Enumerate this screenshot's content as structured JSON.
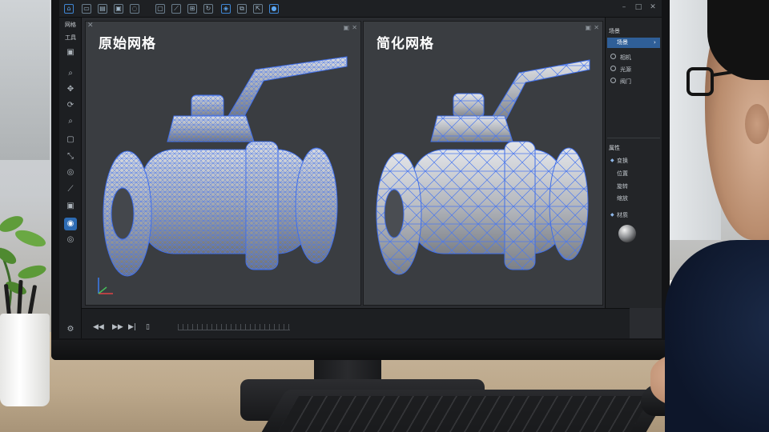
{
  "viewports": {
    "left_title": "原始网格",
    "right_title": "简化网格"
  },
  "left_toolbar": {
    "tab_1": "网格",
    "tab_2": "工具"
  },
  "scene_panel": {
    "title": "场景",
    "selected": "场景",
    "items": [
      "相机",
      "光源",
      "阀门"
    ]
  },
  "properties_panel": {
    "title": "属性",
    "section_transform": "变换",
    "items": [
      "位置",
      "旋转",
      "缩放"
    ],
    "section_material": "材质"
  },
  "colors": {
    "accent": "#2d6bb3",
    "wireframe": "#3f6ee8",
    "mesh": "#c7cad0"
  }
}
